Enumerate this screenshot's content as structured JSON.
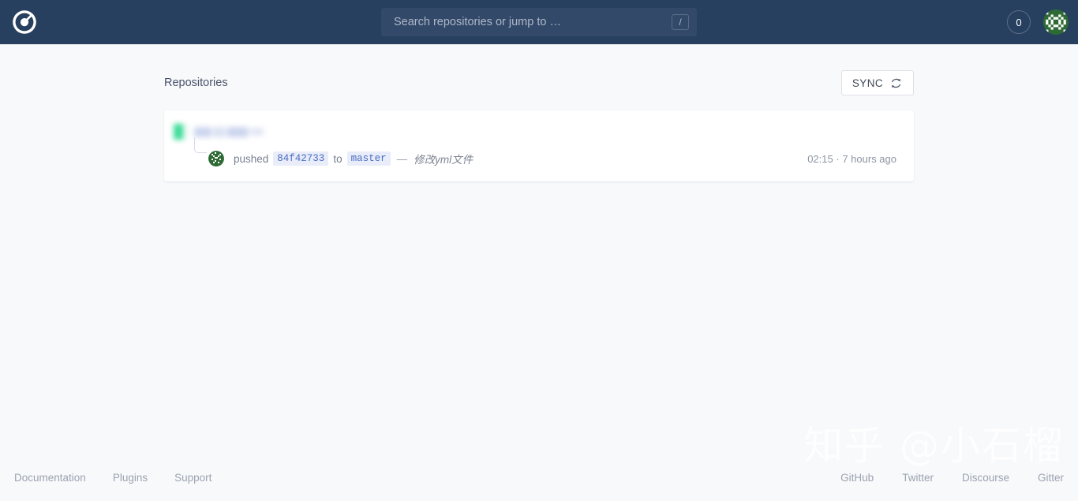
{
  "header": {
    "logo_icon": "drone-logo-icon",
    "search": {
      "placeholder": "Search repositories or jump to …",
      "value": "",
      "shortcut_key": "/"
    },
    "build_count": "0",
    "avatar_alt": "user-identicon"
  },
  "main": {
    "page_title": "Repositories",
    "sync_label": "SYNC",
    "sync_icon": "refresh-icon"
  },
  "repos": [
    {
      "name_redacted": true,
      "status_color": "#3ddc98",
      "activity": {
        "action": "pushed",
        "commit": "84f42733",
        "preposition": "to",
        "branch": "master",
        "separator": "—",
        "message": "修改yml文件",
        "time": "02:15",
        "time_separator": "·",
        "relative_time": "7 hours ago"
      }
    }
  ],
  "footer": {
    "left_links": [
      "Documentation",
      "Plugins",
      "Support"
    ],
    "right_links": [
      "GitHub",
      "Twitter",
      "Discourse",
      "Gitter"
    ]
  },
  "watermark": {
    "text": "知乎 @小石榴"
  },
  "colors": {
    "header_bg": "#27405f",
    "body_bg": "#f8f9fb",
    "accent_chip_bg": "#e9edfa",
    "accent_chip_text": "#4a6cc0",
    "status_green": "#3ddc98"
  }
}
